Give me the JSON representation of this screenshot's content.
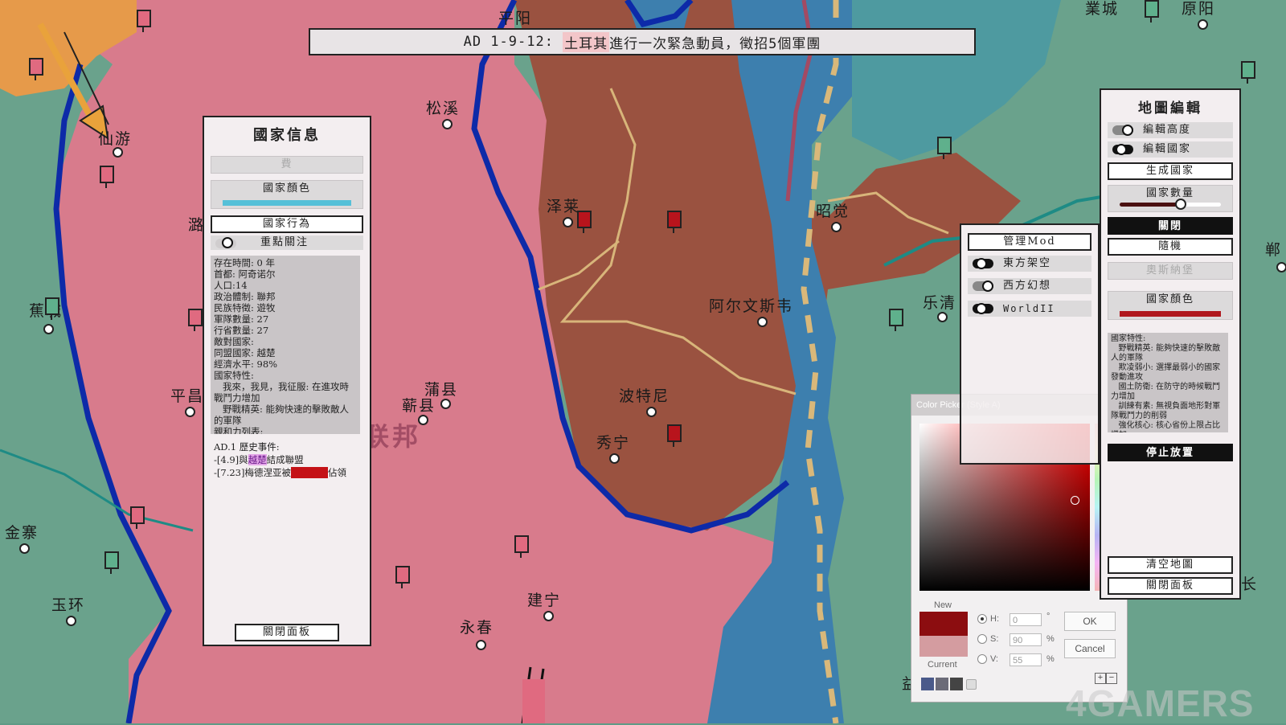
{
  "banner": {
    "prefix": "AD 1-9-12: ",
    "country": "土耳其",
    "message": "進行一次緊急動員，徵招5個軍團"
  },
  "map": {
    "labels": {
      "pingyang": "平阳",
      "yecheng": "業城",
      "yuanyang": "原阳",
      "songxi": "松溪",
      "xianyou": "仙游",
      "zelai": "泽莱",
      "zhaojue": "昭觉",
      "aerwensi": "阿尔文斯韦",
      "leqing": "乐清",
      "jiaocheng": "蕉城",
      "pingchang": "平昌",
      "puxian": "蒲县",
      "puxian2": "蕲县",
      "botenni": "波特尼",
      "xiuning": "秀宁",
      "jinzhai": "金寨",
      "yuhuan": "玉环",
      "jianning": "建宁",
      "yongchun": "永春",
      "nation": "越楚联邦",
      "lu": "潞",
      "ying": "郸",
      "chang": "长",
      "yi": "益"
    }
  },
  "country_info": {
    "title": "國家信息",
    "top_button": "費",
    "color_label": "國家顏色",
    "color_swatch": "#56c0d8",
    "behavior_button": "國家行為",
    "focus_toggle": "重點關注",
    "stats": [
      "存在時間: 0 年",
      "首都: 阿奇诺尔",
      "人口:14",
      "政治體制: 聯邦",
      "民族特徵: 遊牧",
      "軍隊數量: 27",
      "行省數量: 27",
      "敵對國家:",
      "同盟國家: 越楚",
      "經濟水平: 98%",
      "國家特性:",
      "   我來，我見，我征服: 在進攻時戰鬥力增加",
      "   野戰精英: 能夠快速的擊敗敵人的軍隊",
      "親和力列表:"
    ],
    "history_title": "AD.1 歷史事件:",
    "history_1_date": "-[4.9]",
    "history_1_pre": "與",
    "history_1_name": "越楚",
    "history_1_post": "結成聯盟",
    "history_2_date": "-[7.23]",
    "history_2_pre": "梅德涅亚被",
    "history_2_name": "奧斯納堡",
    "history_2_post": "佔領",
    "close_button": "關閉面板"
  },
  "mod_panel": {
    "manage_button": "管理Mod",
    "mods": [
      "東方架空",
      "西方幻想",
      "WorldII"
    ]
  },
  "map_editor": {
    "title": "地圖編輯",
    "toggle_height": "編輯高度",
    "toggle_country": "編輯國家",
    "generate_button": "生成國家",
    "count_label": "國家數量",
    "count_slider_value": 0.6,
    "close_button": "關閉",
    "random_button": "隨機",
    "selected_country": "奧斯納堡",
    "color_label": "國家顏色",
    "color_swatch": "#b0181e",
    "traits": [
      "國家特性:",
      "   野戰精英: 能夠快速的擊敗敵人的軍隊",
      "   欺凌弱小: 選擇最弱小的國家發動進攻",
      "   國土防衛: 在防守的時候戰鬥力增加",
      "   訓練有素: 無視負面地形對軍隊戰鬥力的削弱",
      "   強化核心: 核心省份上限占比增加"
    ],
    "stop_button": "停止放置",
    "clear_button": "清空地圖",
    "close_panel_button": "關閉面板"
  },
  "color_picker": {
    "title": "Color Picker (Style A)",
    "new_label": "New",
    "current_label": "Current",
    "new_color": "#8c0d10",
    "current_color": "#d49ca0",
    "h_label": "H:",
    "h_value": "0",
    "h_unit": "°",
    "s_label": "S:",
    "s_value": "90",
    "s_unit": "%",
    "v_label": "V:",
    "v_value": "55",
    "v_unit": "%",
    "ok": "OK",
    "cancel": "Cancel",
    "plus": "+",
    "minus": "−"
  },
  "watermark": "4GAMERS"
}
